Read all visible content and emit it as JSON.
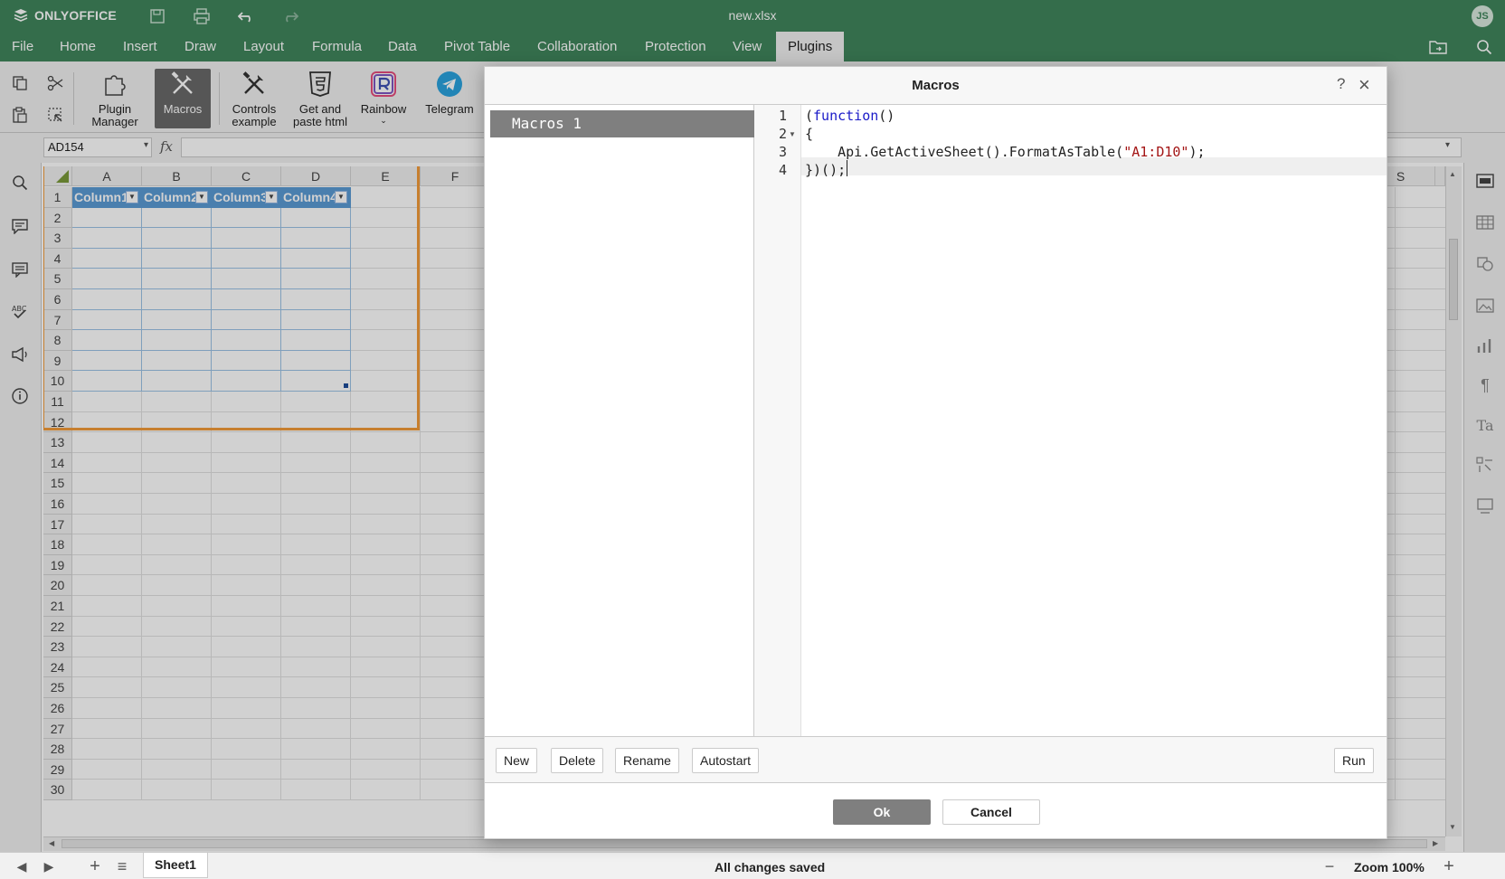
{
  "app": {
    "name": "ONLYOFFICE",
    "document_title": "new.xlsx",
    "user_initials": "JS"
  },
  "menu": {
    "tabs": [
      "File",
      "Home",
      "Insert",
      "Draw",
      "Layout",
      "Formula",
      "Data",
      "Pivot Table",
      "Collaboration",
      "Protection",
      "View",
      "Plugins"
    ],
    "active_tab": "Plugins"
  },
  "toolbar": {
    "plugin_manager": "Plugin Manager",
    "macros": "Macros",
    "controls_example": "Controls example",
    "get_paste_html": "Get and paste html",
    "rainbow": "Rainbow",
    "telegram": "Telegram"
  },
  "formula_bar": {
    "name_box": "AD154",
    "fx": "fx",
    "value": ""
  },
  "sheet": {
    "columns": [
      "A",
      "B",
      "C",
      "D",
      "E",
      "F"
    ],
    "far_column": "S",
    "rows": [
      "1",
      "2",
      "3",
      "4",
      "5",
      "6",
      "7",
      "8",
      "9",
      "10",
      "11",
      "12",
      "13",
      "14",
      "15",
      "16",
      "17",
      "18",
      "19",
      "20",
      "21",
      "22",
      "23",
      "24",
      "25",
      "26",
      "27",
      "28",
      "29",
      "30"
    ],
    "table_headers": [
      "Column1",
      "Column2",
      "Column3",
      "Column4"
    ]
  },
  "macros_dialog": {
    "title": "Macros",
    "help": "?",
    "macro_list": [
      "Macros 1"
    ],
    "code": {
      "line_numbers": [
        "1",
        "2",
        "3",
        "4"
      ],
      "line1_open": "(",
      "line1_kw": "function",
      "line1_close": "()",
      "line2": "{",
      "line3_pre": "    Api.GetActiveSheet().FormatAsTable(",
      "line3_str": "\"A1:D10\"",
      "line3_post": ");",
      "line4": "})();"
    },
    "buttons": {
      "new": "New",
      "delete": "Delete",
      "rename": "Rename",
      "autostart": "Autostart",
      "run": "Run",
      "ok": "Ok",
      "cancel": "Cancel"
    }
  },
  "status": {
    "sheet_tab": "Sheet1",
    "saved": "All changes saved",
    "zoom": "Zoom 100%"
  },
  "colors": {
    "brand_green": "#40865c",
    "table_header_blue": "#5b9bd5",
    "selection_orange": "#f39c3a"
  }
}
